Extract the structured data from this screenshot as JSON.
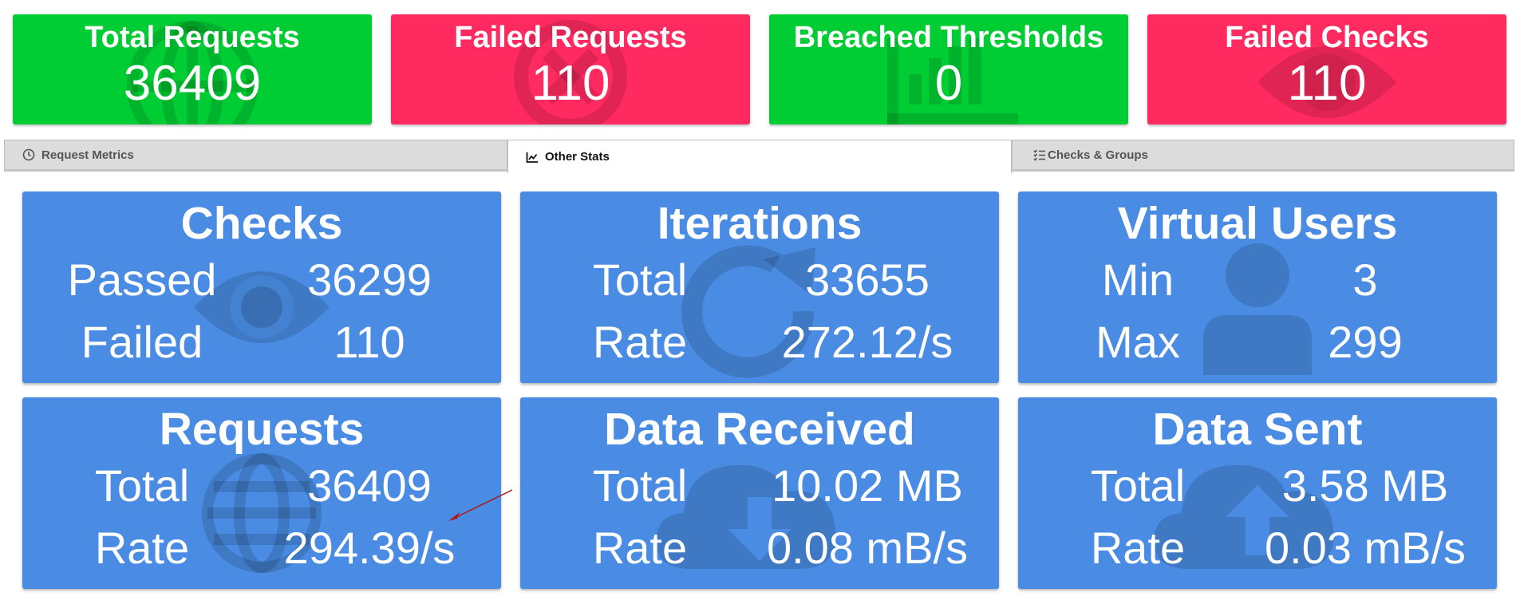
{
  "summary": {
    "total_requests": {
      "label": "Total Requests",
      "value": "36409",
      "icon": "globe-icon",
      "color": "#00cc33"
    },
    "failed_requests": {
      "label": "Failed Requests",
      "value": "110",
      "icon": "times-circle-icon",
      "color": "#ff2a5f"
    },
    "breached_thresholds": {
      "label": "Breached Thresholds",
      "value": "0",
      "icon": "bar-chart-icon",
      "color": "#00cc33"
    },
    "failed_checks": {
      "label": "Failed Checks",
      "value": "110",
      "icon": "eye-icon",
      "color": "#ff2a5f"
    }
  },
  "tabs": [
    {
      "label": "Request Metrics",
      "icon": "clock-icon",
      "active": false
    },
    {
      "label": "Other Stats",
      "icon": "line-chart-icon",
      "active": true
    },
    {
      "label": "Checks & Groups",
      "icon": "list-check-icon",
      "active": false
    }
  ],
  "stats": {
    "checks": {
      "title": "Checks",
      "icon": "eye-icon",
      "rows": [
        {
          "label": "Passed",
          "value": "36299"
        },
        {
          "label": "Failed",
          "value": "110"
        }
      ]
    },
    "iterations": {
      "title": "Iterations",
      "icon": "redo-icon",
      "rows": [
        {
          "label": "Total",
          "value": "33655"
        },
        {
          "label": "Rate",
          "value": "272.12/s"
        }
      ]
    },
    "virtual_users": {
      "title": "Virtual Users",
      "icon": "user-icon",
      "rows": [
        {
          "label": "Min",
          "value": "3"
        },
        {
          "label": "Max",
          "value": "299"
        }
      ]
    },
    "requests": {
      "title": "Requests",
      "icon": "globe-icon",
      "rows": [
        {
          "label": "Total",
          "value": "36409"
        },
        {
          "label": "Rate",
          "value": "294.39/s"
        }
      ]
    },
    "data_received": {
      "title": "Data Received",
      "icon": "cloud-download-icon",
      "rows": [
        {
          "label": "Total",
          "value": "10.02 MB"
        },
        {
          "label": "Rate",
          "value": "0.08 mB/s"
        }
      ]
    },
    "data_sent": {
      "title": "Data Sent",
      "icon": "cloud-upload-icon",
      "rows": [
        {
          "label": "Total",
          "value": "3.58 MB"
        },
        {
          "label": "Rate",
          "value": "0.03 mB/s"
        }
      ]
    }
  },
  "colors": {
    "card_blue": "#4a8ce3",
    "green": "#00cc33",
    "red": "#ff2a5f",
    "annotation_arrow": "#b01818"
  }
}
